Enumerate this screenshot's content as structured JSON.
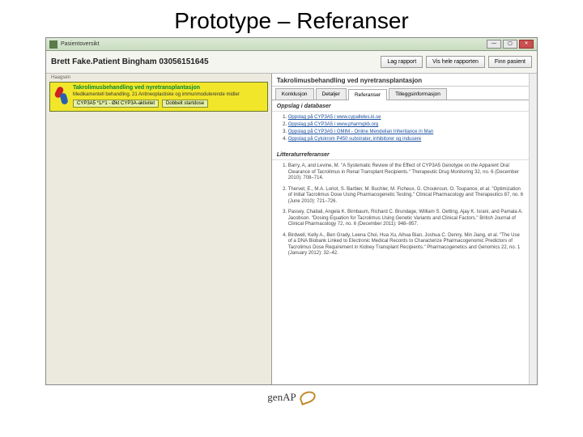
{
  "slide_title": "Prototype – Referanser",
  "titlebar": {
    "text": "Pasientoversikt"
  },
  "window_buttons": {
    "min": "—",
    "max": "▢",
    "close": "✕"
  },
  "header": {
    "patient_name": "Brett Fake.Patient Bingham 03056151645",
    "btn_report": "Lag rapport",
    "btn_show_report": "Vis hele rapporten",
    "btn_find_patient": "Finn pasient"
  },
  "left": {
    "haagsen": "Haagsen",
    "yellow_title": "Takrolimusbehandling ved nyretransplantasjon",
    "yellow_sub": "Medikamentell behandling. 21 Antineoplastiske og immunmodulerende midler",
    "chip1": "CYP3A5 *1/*1 - Økt CYP3A-aktivitet",
    "chip2": "Dobbelt startdose"
  },
  "right": {
    "title": "Takrolimusbehandling ved nyretransplantasjon",
    "tabs": {
      "t1": "Konklusjon",
      "t2": "Detaljer",
      "t3": "Referanser",
      "t4": "Tilleggsinformasjon"
    },
    "section_db": "Oppslag i databaser",
    "db_links": [
      "Oppslag på CYP3A5 i www.cypalleles.ki.se",
      "Oppslag på CYP3A5 i www.pharmgkb.org",
      "Oppslag på CYP3A5 i OMIM - Online Mendelian Inheritance in Man",
      "Oppslag på Cytokrom P450 substrater, inhibitorer og indusere"
    ],
    "section_lit": "Litteraturreferanser",
    "lit_refs": [
      "Barry, A, and Levine, M. \"A Systematic Review of the Effect of CYP3A5 Genotype on the Apparent Oral Clearance of Tacrolimus in Renal Transplant Recipients.\" Therapeutic Drug Monitoring 32, no. 6 (December 2010): 708–714.",
      "Thervet, E., M.A. Loriot, S. Barbier, M. Buchler, M. Ficheux, G. Choukroun, O. Toupance, et al. \"Optimization of Initial Tacrolimus Dose Using Pharmacogenetic Testing.\" Clinical Pharmacology and Therapeutics 87, no. 6 (June 2010): 721–726.",
      "Passey, Chaitali, Angela K. Birnbaum, Richard C. Brundage, William S. Oetting, Ajay K. Israni, and Pamala A. Jacobson. \"Dosing Equation for Tacrolimus Using Genetic Variants and Clinical Factors.\" British Journal of Clinical Pharmacology 72, no. 6 (December 2011): 948–957.",
      "Birdwell, Kelly A., Ben Grady, Leena Choi, Hua Xu, Aihua Bian, Joshua C. Denny, Min Jiang, et al. \"The Use of a DNA Biobank Linked to Electronic Medical Records to Characterize Pharmacogenomic Predictors of Tacrolimus Dose Requirement in Kidney Transplant Recipients.\" Pharmacogenetics and Genomics 22, no. 1 (January 2012): 32–42."
    ]
  },
  "footer_logo": "genAP"
}
